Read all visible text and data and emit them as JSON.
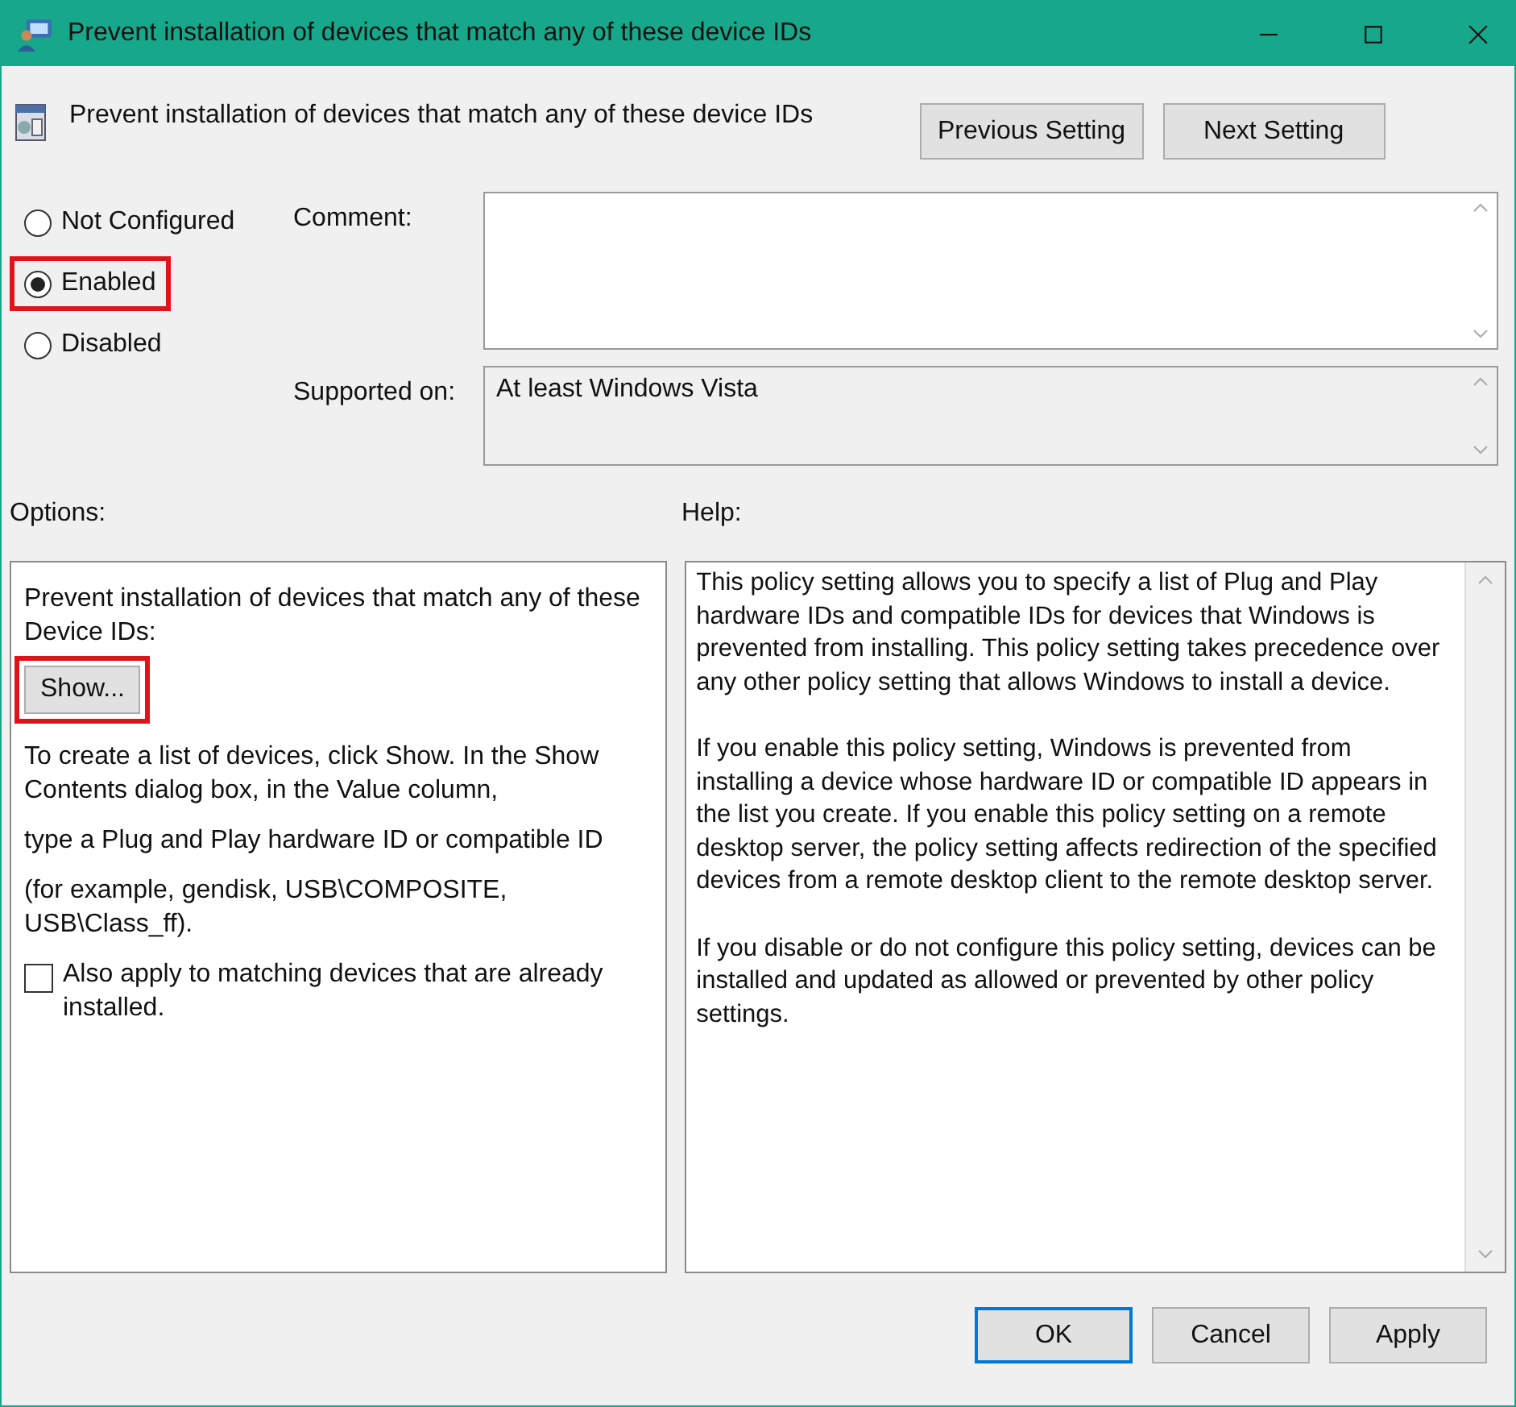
{
  "window": {
    "title": "Prevent installation of devices that match any of these device IDs"
  },
  "policy": {
    "title": "Prevent installation of devices that match any of these device IDs"
  },
  "nav_buttons": [
    "Previous Setting",
    "Next Setting"
  ],
  "states": [
    {
      "label": "Not Configured",
      "selected": false,
      "highlighted": false
    },
    {
      "label": "Enabled",
      "selected": true,
      "highlighted": true
    },
    {
      "label": "Disabled",
      "selected": false,
      "highlighted": false
    }
  ],
  "comment": {
    "label": "Comment:"
  },
  "supported_on": {
    "label": "Supported on:",
    "value": "At least Windows Vista"
  },
  "options": {
    "label": "Options:",
    "intro": "Prevent installation of devices that match any of these Device IDs:",
    "show_button": {
      "label": "Show...",
      "highlighted": true
    },
    "paragraphs": [
      "To create a list of devices, click Show. In the Show Contents dialog box, in the Value column,",
      "type a Plug and Play hardware ID or compatible ID",
      "(for example, gendisk, USB\\COMPOSITE, USB\\Class_ff)."
    ],
    "checkbox": {
      "label": "Also apply to matching devices that are already installed.",
      "checked": false
    }
  },
  "help": {
    "label": "Help:",
    "paragraphs": [
      "This policy setting allows you to specify a list of Plug and Play hardware IDs and compatible IDs for devices that Windows is prevented from installing. This policy setting takes precedence over any other policy setting that allows Windows to install a device.",
      "If you enable this policy setting, Windows is prevented from installing a device whose hardware ID or compatible ID appears in the list you create. If you enable this policy setting on a remote desktop server, the policy setting affects redirection of the specified devices from a remote desktop client to the remote desktop server.",
      "If you disable or do not configure this policy setting, devices can be installed and updated as allowed or prevented by other policy settings."
    ]
  },
  "buttons": [
    {
      "label": "OK",
      "default": true
    },
    {
      "label": "Cancel",
      "default": false
    },
    {
      "label": "Apply",
      "default": false
    }
  ]
}
